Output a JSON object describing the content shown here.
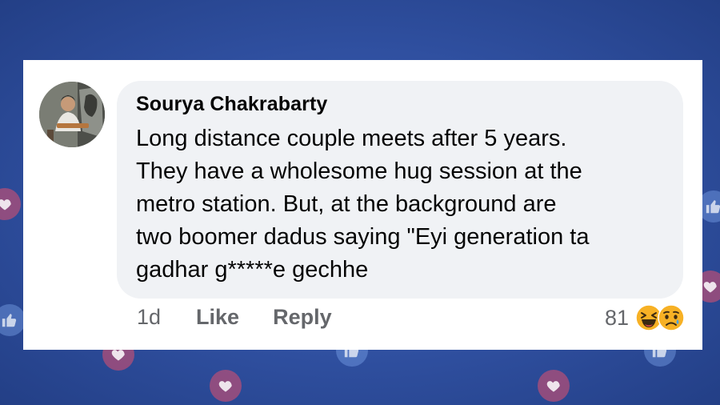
{
  "comment": {
    "author": "Sourya Chakrabarty",
    "lines": [
      "Long distance couple meets after 5 years.",
      "They have a wholesome hug session at the",
      "metro station. But, at the background are",
      "two boomer dadus saying \"Eyi generation ta",
      "gadhar g*****e gechhe"
    ],
    "time": "1d",
    "like_label": "Like",
    "reply_label": "Reply",
    "reaction_count": "81",
    "reactions": [
      "haha-emoji-icon",
      "sad-emoji-icon"
    ]
  },
  "colors": {
    "background": "#2f4f9f",
    "bubble": "#f0f2f5",
    "text": "#050505",
    "secondary_text": "#65676b",
    "emoji_yellow": "#f7b125"
  }
}
